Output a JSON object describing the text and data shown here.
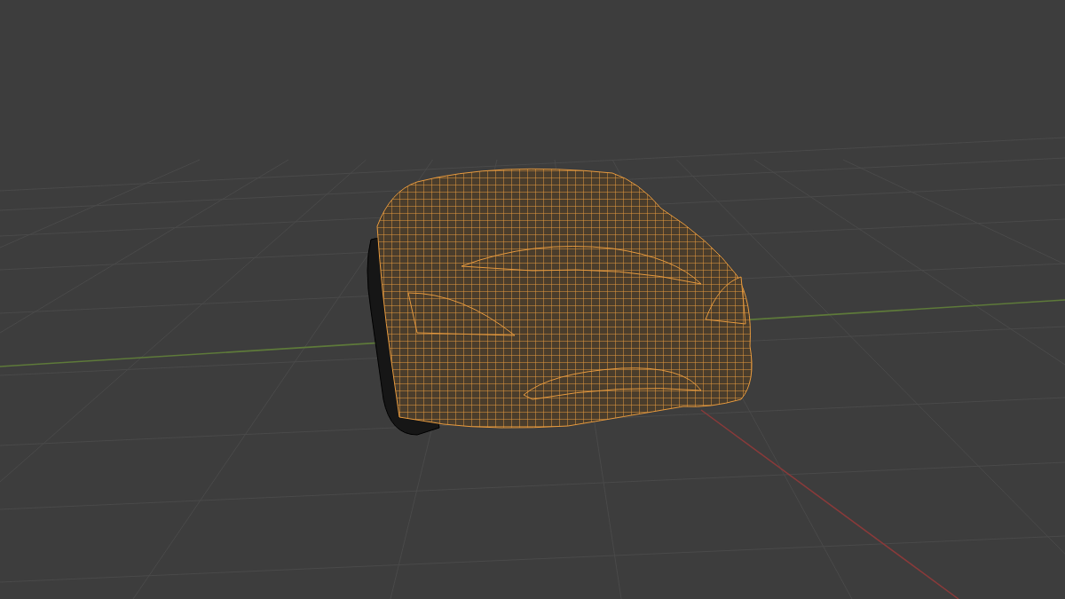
{
  "viewport": {
    "objects": [
      {
        "kind": "car",
        "selected": true
      }
    ]
  }
}
